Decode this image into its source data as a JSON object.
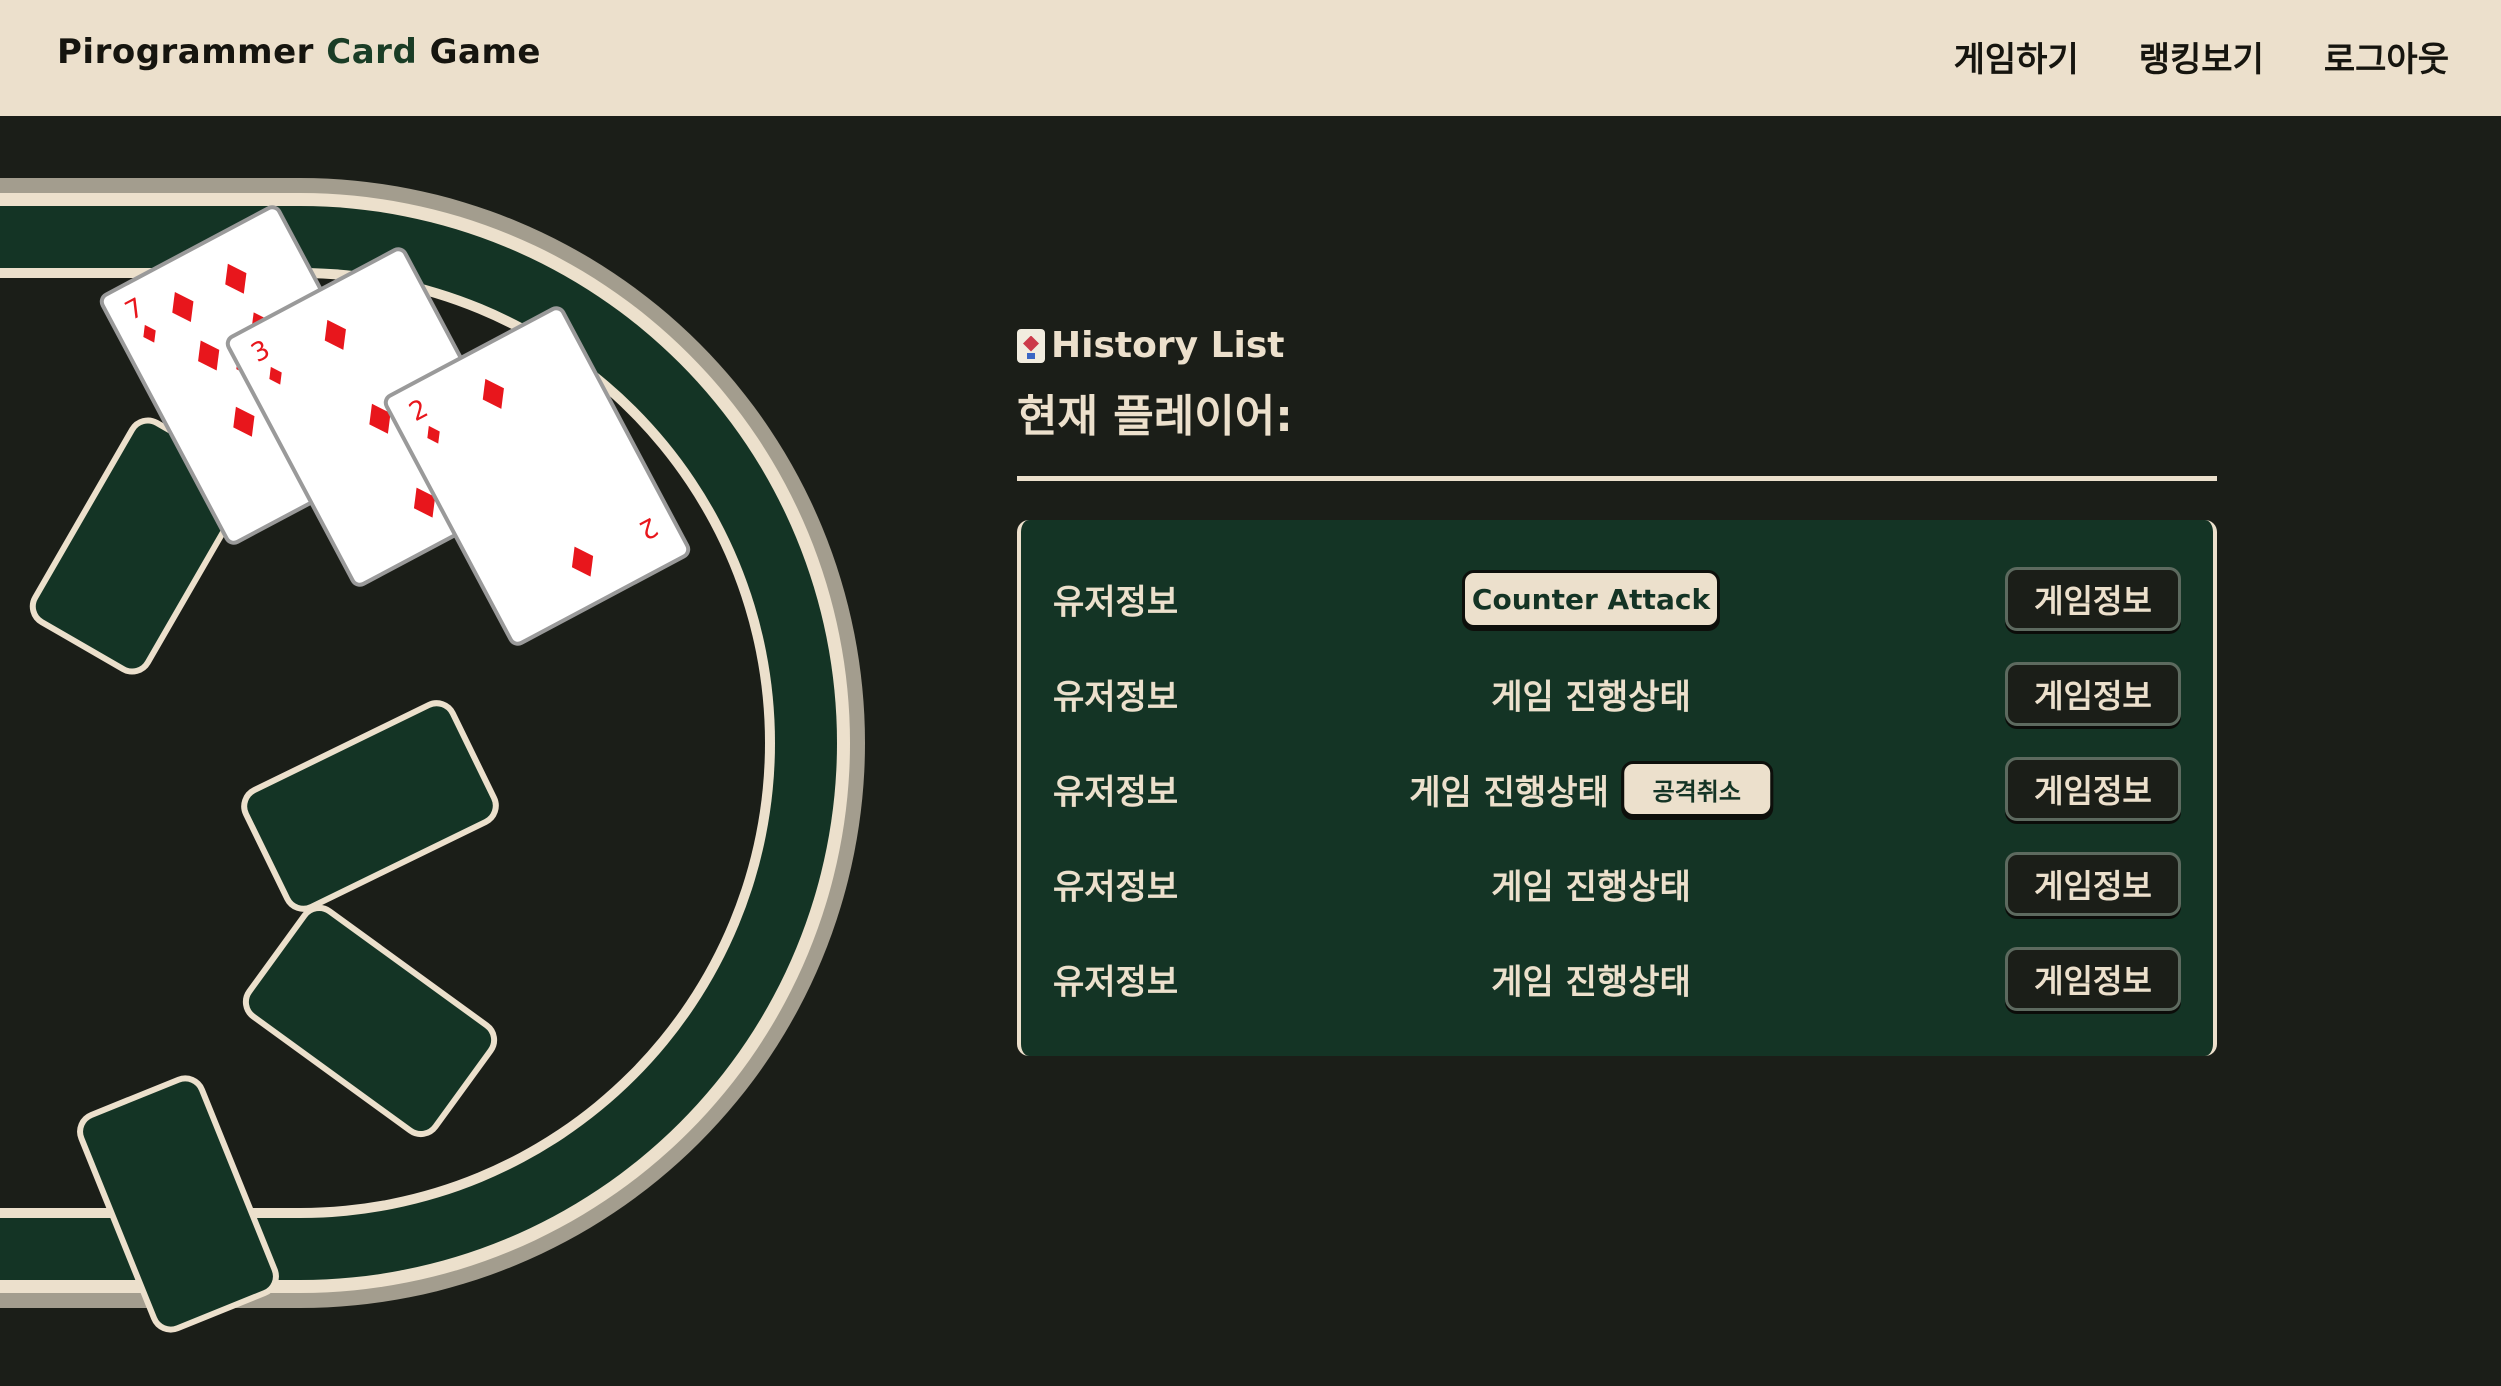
{
  "header": {
    "brand_prefix": "Pirogrammer ",
    "brand_accent": "Card",
    "brand_suffix": " Game",
    "nav": [
      "게임하기",
      "랭킹보기",
      "로그아웃"
    ]
  },
  "table_cards": [
    {
      "rank": "7",
      "suit": "diamonds"
    },
    {
      "rank": "3",
      "suit": "diamonds"
    },
    {
      "rank": "2",
      "suit": "diamonds"
    }
  ],
  "history": {
    "icon": "joker-card-icon",
    "title": "History List",
    "current_player_label": "현재 플레이어:",
    "rows": [
      {
        "user": "유저정보",
        "center_button": "Counter Attack",
        "info_button": "게임정보"
      },
      {
        "user": "유저정보",
        "status": "게임 진행상태",
        "info_button": "게임정보"
      },
      {
        "user": "유저정보",
        "status": "게임 진행상태",
        "cancel_button": "공격취소",
        "info_button": "게임정보"
      },
      {
        "user": "유저정보",
        "status": "게임 진행상태",
        "info_button": "게임정보"
      },
      {
        "user": "유저정보",
        "status": "게임 진행상태",
        "info_button": "게임정보"
      }
    ]
  },
  "colors": {
    "background": "#1b1e18",
    "header_bg": "#ece0cc",
    "felt_green": "#143425",
    "accent_text": "#1a3d26",
    "cream": "#ece0cc",
    "diamond_red": "#e8161c"
  }
}
